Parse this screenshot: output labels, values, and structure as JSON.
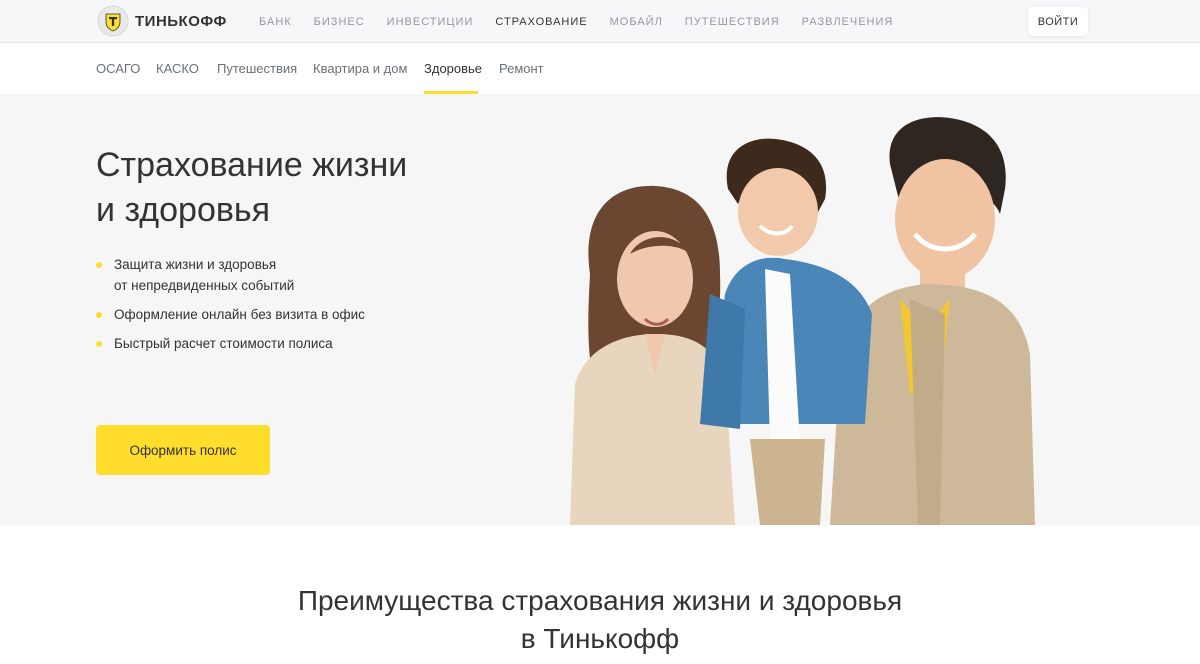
{
  "header": {
    "logo_text": "ТИНЬКОФФ",
    "nav": [
      "БАНК",
      "БИЗНЕС",
      "ИНВЕСТИЦИИ",
      "СТРАХОВАНИЕ",
      "МОБАЙЛ",
      "ПУТЕШЕСТВИЯ",
      "РАЗВЛЕЧЕНИЯ"
    ],
    "active_nav": "СТРАХОВАНИЕ",
    "login_label": "ВОЙТИ"
  },
  "subnav": {
    "items": [
      "ОСАГО",
      "КАСКО",
      "Путешествия",
      "Квартира и дом",
      "Здоровье",
      "Ремонт"
    ],
    "active": "Здоровье"
  },
  "hero": {
    "title_line1": "Страхование жизни",
    "title_line2": "и здоровья",
    "bullets": [
      {
        "line1": "Защита жизни и здоровья",
        "line2": "от непредвиденных событий"
      },
      {
        "line1": "Оформление онлайн без визита в офис",
        "line2": ""
      },
      {
        "line1": "Быстрый расчет стоимости полиса",
        "line2": ""
      }
    ],
    "cta_label": "Оформить полис"
  },
  "section": {
    "title_line1": "Преимущества страхования жизни и здоровья",
    "title_line2": "в Тинькофф"
  },
  "colors": {
    "accent": "#ffdd2d",
    "text": "#333333",
    "hero_bg": "#f6f6f6",
    "topbar_bg": "#f6f7f8"
  }
}
